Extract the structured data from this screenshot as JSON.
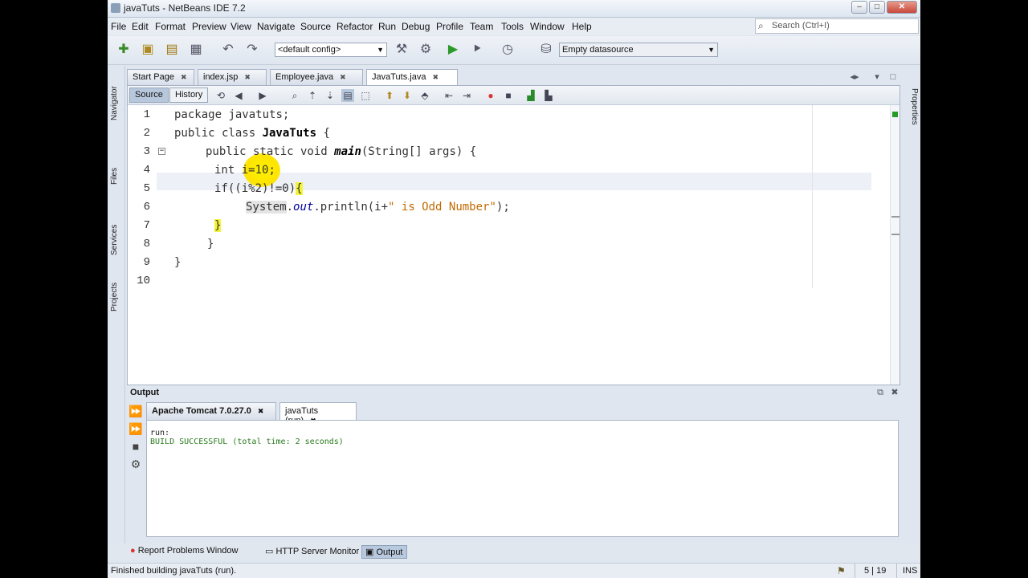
{
  "window": {
    "title": "javaTuts - NetBeans IDE 7.2"
  },
  "menu": [
    "File",
    "Edit",
    "Format",
    "Preview",
    "View",
    "Navigate",
    "Source",
    "Refactor",
    "Run",
    "Debug",
    "Profile",
    "Team",
    "Tools",
    "Window",
    "Help"
  ],
  "search": {
    "placeholder": "Search (Ctrl+I)"
  },
  "toolbar": {
    "config": "<default config>",
    "datasource": "Empty datasource"
  },
  "side_tabs": {
    "navigator": "Navigator",
    "files": "Files",
    "services": "Services",
    "projects": "Projects",
    "properties": "Properties"
  },
  "editor_tabs": [
    "Start Page",
    "index.jsp",
    "Employee.java",
    "JavaTuts.java"
  ],
  "editor_toolbar": {
    "source": "Source",
    "history": "History"
  },
  "code": {
    "line_numbers": [
      "1",
      "2",
      "3",
      "4",
      "5",
      "6",
      "7",
      "8",
      "9",
      "10"
    ],
    "l1": {
      "kw": "package",
      "rest": " javatuts;"
    },
    "l2": {
      "kw": "public class ",
      "cls": "JavaTuts",
      "rest": " {"
    },
    "l3": {
      "kw": "public static void ",
      "mth": "main",
      "rest": "(String[] args) {"
    },
    "l4": {
      "kw": "int",
      "rest": " i=10;"
    },
    "l5": {
      "kw": "if",
      "rest": "((i%2)!=0)",
      "brace": "{"
    },
    "l6": {
      "sys": "System",
      "dot": ".",
      "fld": "out",
      "call": ".println(i+",
      "str": "\" is Odd Number\"",
      "end": ");"
    },
    "l7": {
      "brace": "}"
    },
    "l8": {
      "text": "}"
    },
    "l9": {
      "text": "}"
    }
  },
  "output": {
    "header": "Output",
    "tabs": [
      "Apache Tomcat 7.0.27.0",
      "javaTuts (run)"
    ],
    "lines": [
      "run:",
      "BUILD SUCCESSFUL (total time: 2 seconds)"
    ]
  },
  "bottom_tabs": [
    "Report Problems Window",
    "HTTP Server Monitor",
    "Output"
  ],
  "status": {
    "message": "Finished building javaTuts (run).",
    "position": "5 | 19",
    "mode": "INS"
  }
}
